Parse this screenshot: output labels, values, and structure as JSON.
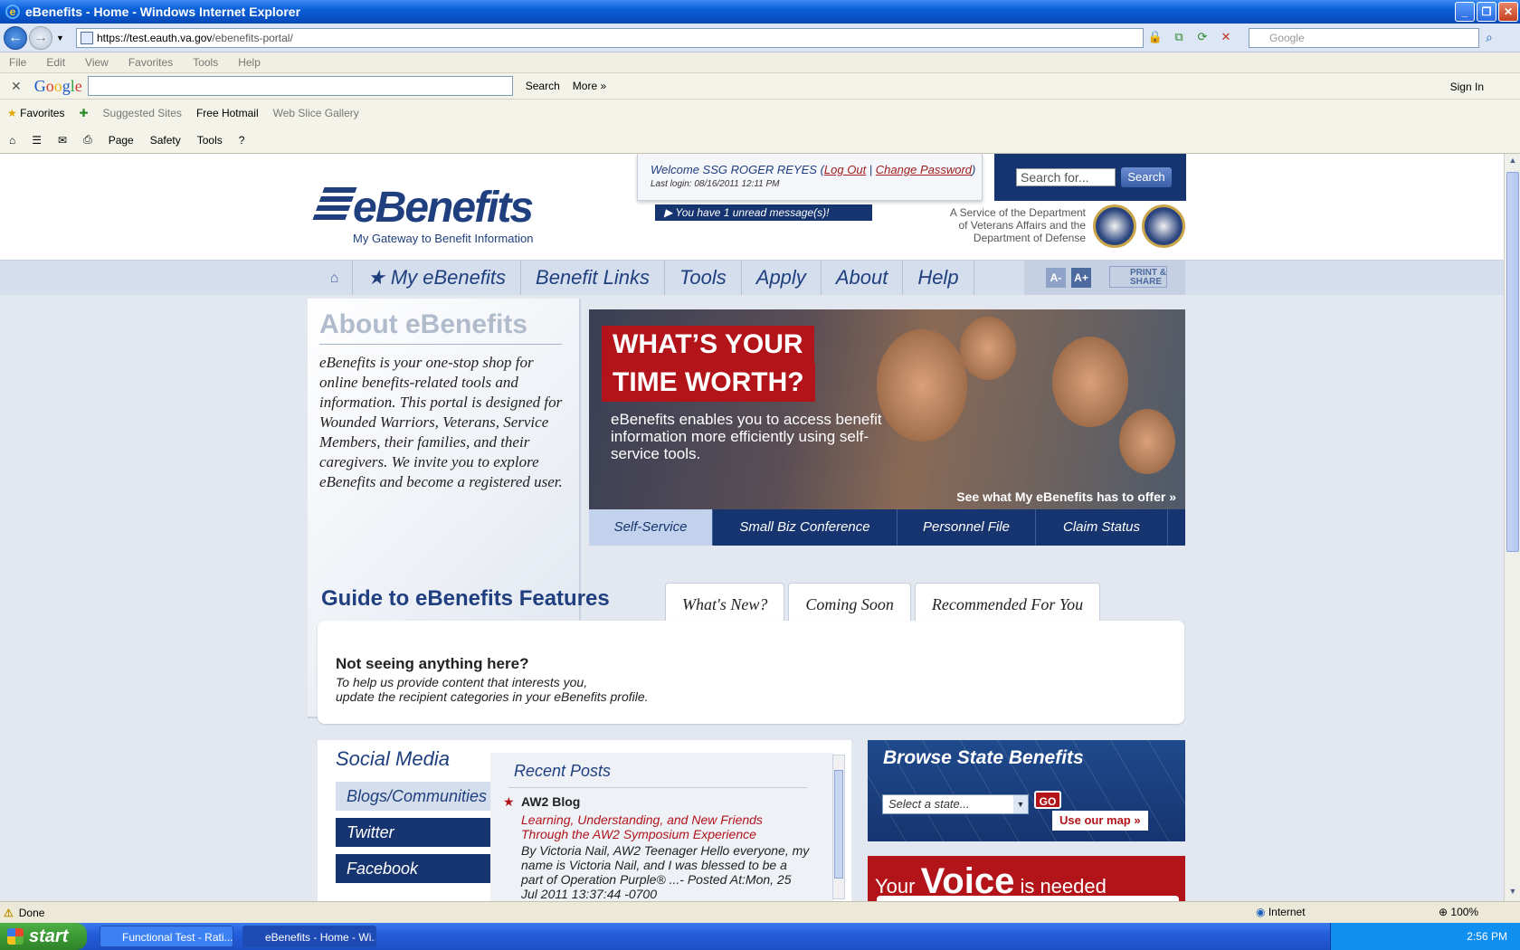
{
  "window": {
    "title": "eBenefits - Home - Windows Internet Explorer",
    "address_host": "https://test.eauth.",
    "address_domain": "va.gov",
    "address_path": "/ebenefits-portal/",
    "search_placeholder": "Google"
  },
  "menubar": [
    "File",
    "Edit",
    "View",
    "Favorites",
    "Tools",
    "Help"
  ],
  "google_toolbar": {
    "search_label": "Search",
    "more_label": "More »",
    "signin_label": "Sign In"
  },
  "favorites_bar": {
    "favorites_label": "Favorites",
    "suggested_sites": "Suggested Sites",
    "free_hotmail": "Free Hotmail",
    "web_slice": "Web Slice Gallery"
  },
  "command_bar": {
    "page": "Page",
    "safety": "Safety",
    "tools": "Tools"
  },
  "header": {
    "logo_word": "eBenefits",
    "tagline": "My Gateway to Benefit Information",
    "welcome_prefix": "Welcome SSG ROGER REYES (",
    "logout": "Log Out",
    "sep": " | ",
    "change_password": "Change Password",
    "welcome_suffix": ")",
    "last_login": "Last login: 08/16/2011 12:11 PM",
    "unread": "You have 1 unread message(s)!",
    "search_placeholder": "Search for...",
    "search_button": "Search",
    "service_line1": "A Service of the Department",
    "service_line2": "of Veterans Affairs and the",
    "service_line3": "Department of Defense"
  },
  "nav": {
    "items": [
      "★ My eBenefits",
      "Benefit Links",
      "Tools",
      "Apply",
      "About",
      "Help"
    ],
    "font_smaller": "A-",
    "font_larger": "A+",
    "print_share": "PRINT & SHARE"
  },
  "about": {
    "title": "About eBenefits",
    "text": "eBenefits is your one-stop shop for online benefits-related tools and information. This portal is designed for Wounded Warriors, Veterans, Service Members, their families, and their caregivers. We invite you to explore eBenefits and become a registered user."
  },
  "hero": {
    "headline1": "WHAT’S YOUR",
    "headline2": "TIME WORTH?",
    "subtext": "eBenefits enables you to access benefit information more efficiently using self-service tools.",
    "see_link": "See what My eBenefits has to offer »",
    "tabs": [
      "Self-Service",
      "Small Biz Conference",
      "Personnel File",
      "Claim Status"
    ]
  },
  "guide": {
    "title": "Guide to eBenefits Features",
    "tabs": [
      "What's New?",
      "Coming Soon",
      "Recommended For You"
    ],
    "empty_title": "Not seeing anything here?",
    "empty_line1": "To help us provide content that interests you,",
    "empty_line2": "update the recipient categories in your eBenefits profile."
  },
  "social": {
    "title": "Social Media",
    "buttons": [
      "Blogs/Communities",
      "Twitter",
      "Facebook"
    ],
    "recent_title": "Recent Posts",
    "blog_name": "AW2 Blog",
    "post_title": "Learning, Understanding, and New Friends Through the AW2 Symposium Experience",
    "post_body": "By Victoria Nail, AW2 Teenager Hello everyone, my name is Victoria Nail, and I was blessed to be a part of Operation Purple® ...- Posted At:Mon, 25 Jul 2011 13:37:44 -0700"
  },
  "state_benefits": {
    "title": "Browse State Benefits",
    "select_placeholder": "Select a state...",
    "go": "GO",
    "map_link": "Use our map »"
  },
  "voice": {
    "your": "Your ",
    "voice": "Voice",
    "needed": " is needed"
  },
  "status": {
    "left": "Done",
    "zone": "Internet",
    "zoom": "100%"
  },
  "taskbar": {
    "start": "start",
    "items": [
      "Functional Test - Rati...",
      "eBenefits - Home - Wi..."
    ],
    "clock": "2:56 PM"
  }
}
